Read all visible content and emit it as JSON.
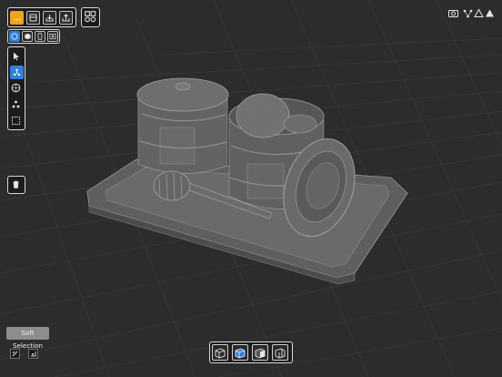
{
  "app": {
    "accent_orange": "#f4a21b",
    "accent_blue": "#2f80e0"
  },
  "top_toolbar": {
    "items": [
      "menu-icon",
      "layers-icon",
      "import-icon",
      "export-icon"
    ],
    "extra": "objects-icon"
  },
  "view_modes": [
    "sphere-view-icon",
    "cube-view-icon",
    "cylinder-view-icon",
    "box-view-icon"
  ],
  "tools": [
    "select-arrow-icon",
    "vertex-tool-icon",
    "sphere-select-icon",
    "joint-tool-icon",
    "box-select-icon"
  ],
  "delete": "trash-icon",
  "top_right": [
    "camera-icon",
    "snap-icon",
    "triangle-icon",
    "expand-icon"
  ],
  "soft_selection": {
    "label": "Soft Selection"
  },
  "bottom_left": [
    "soft-falloff-icon",
    "soft-radius-icon"
  ],
  "display_modes": [
    "wireframe-box-icon",
    "solid-box-icon",
    "shaded-box-icon",
    "split-box-icon"
  ],
  "scene": {
    "objects": [
      "tray",
      "jar-left",
      "jar-right",
      "lid",
      "honey-dipper"
    ]
  }
}
